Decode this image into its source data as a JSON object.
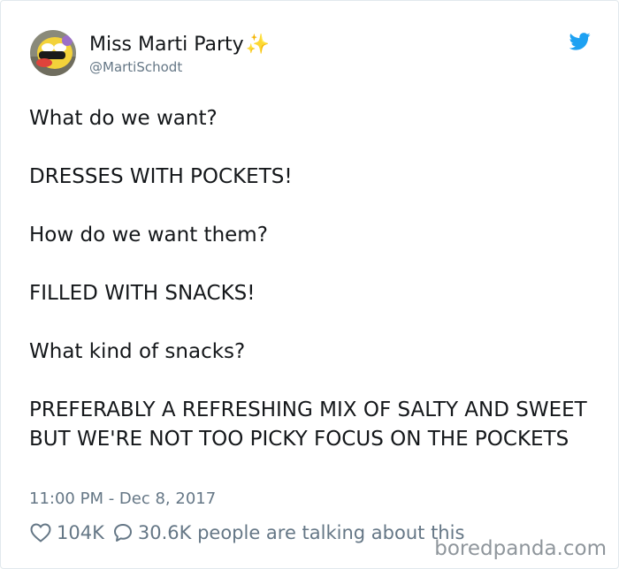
{
  "author": {
    "display_name": "Miss Marti Party",
    "emoji": "✨",
    "handle": "@MartiSchodt"
  },
  "tweet": {
    "lines": [
      "What do we want?",
      "DRESSES WITH POCKETS!",
      "How do we want them?",
      "FILLED WITH SNACKS!",
      "What kind of snacks?",
      "PREFERABLY A REFRESHING MIX OF SALTY AND SWEET BUT WE'RE NOT TOO PICKY FOCUS ON THE POCKETS"
    ],
    "timestamp": "11:00 PM - Dec 8, 2017"
  },
  "stats": {
    "likes": "104K",
    "replies": "30.6K people are talking about this"
  },
  "watermark": "boredpanda.com",
  "colors": {
    "twitter_blue": "#1da1f2",
    "text": "#14171a",
    "muted": "#657786"
  },
  "icons": {
    "brand": "twitter-bird-icon",
    "like": "heart-icon",
    "reply": "comment-bubble-icon"
  }
}
